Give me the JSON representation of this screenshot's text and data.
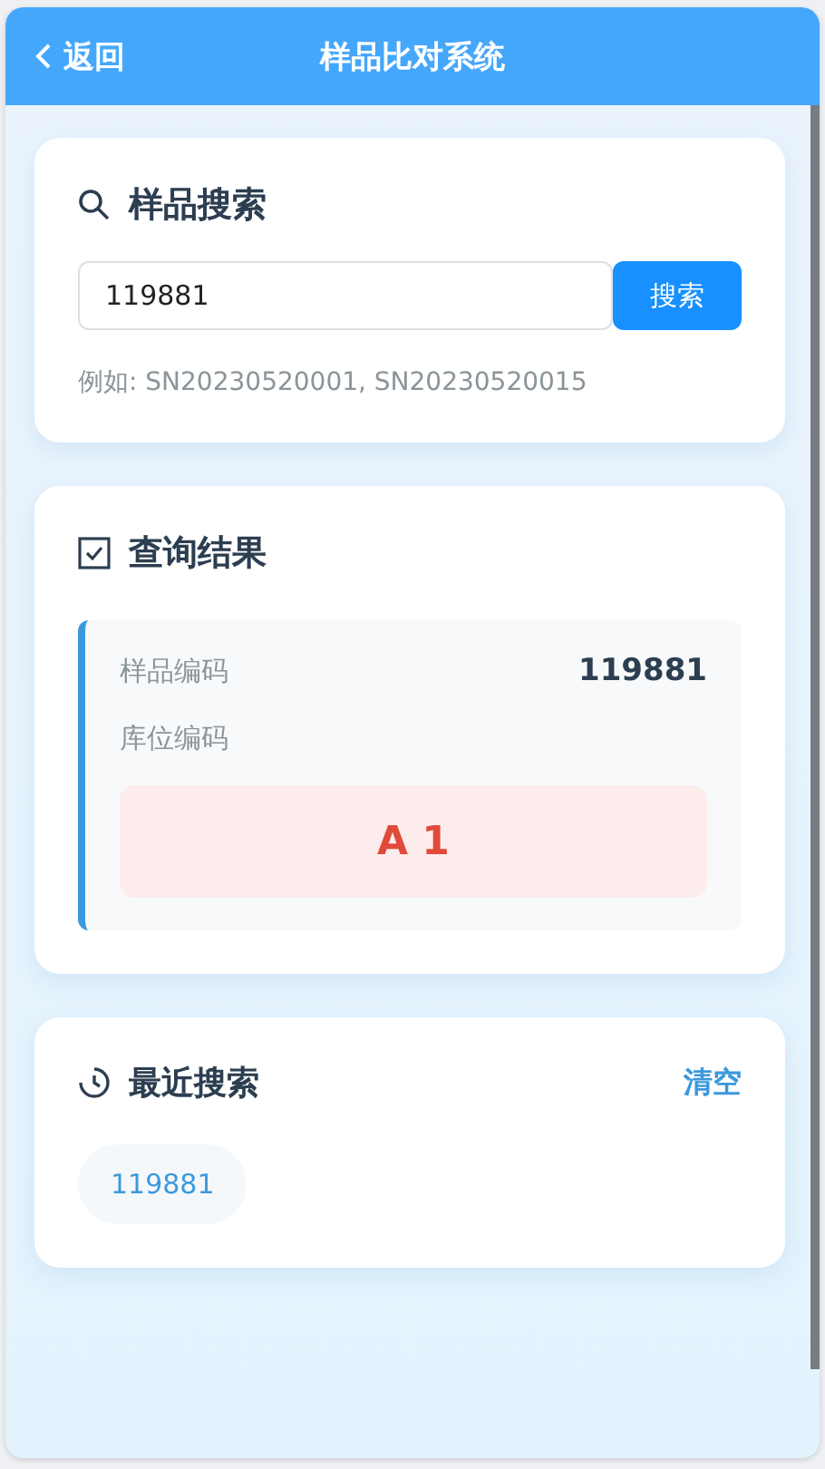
{
  "header": {
    "back": "返回",
    "title": "样品比对系统"
  },
  "search": {
    "title": "样品搜索",
    "value": "119881",
    "button": "搜索",
    "hint": "例如: SN20230520001, SN20230520015"
  },
  "result": {
    "title": "查询结果",
    "sample_label": "样品编码",
    "sample_value": "119881",
    "location_label": "库位编码",
    "location_value": "A 1"
  },
  "recent": {
    "title": "最近搜索",
    "clear": "清空",
    "items": [
      "119881"
    ]
  }
}
